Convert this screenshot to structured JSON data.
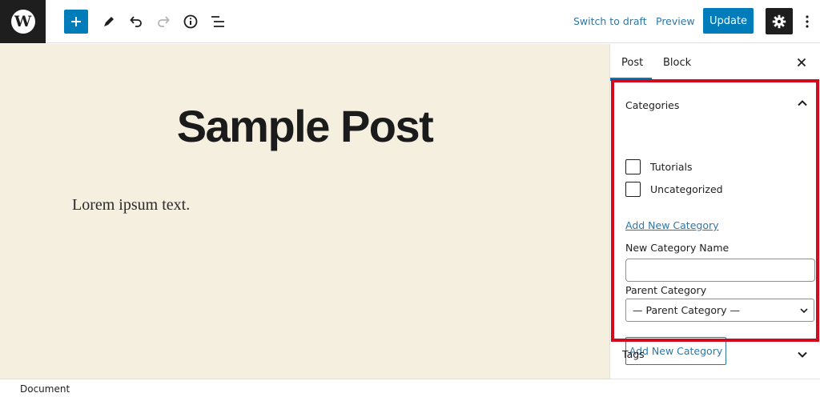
{
  "toolbar": {
    "logo_icon": "wordpress-logo",
    "logo_glyph": "W",
    "add_block_icon": "plus-icon",
    "tools_icon": "pencil-icon",
    "undo_icon": "undo-icon",
    "redo_icon": "redo-icon",
    "details_icon": "info-icon",
    "list_view_icon": "list-view-icon",
    "switch_to_draft": "Switch to draft",
    "preview": "Preview",
    "update": "Update",
    "settings_icon": "gear-icon",
    "more_icon": "kebab-menu-icon"
  },
  "editor": {
    "title": "Sample Post",
    "body": "Lorem ipsum text."
  },
  "sidebar": {
    "tabs": [
      {
        "label": "Post",
        "active": true
      },
      {
        "label": "Block",
        "active": false
      }
    ],
    "close_icon": "close-icon",
    "categories": {
      "title": "Categories",
      "expanded": true,
      "items": [
        {
          "label": "Tutorials",
          "checked": false
        },
        {
          "label": "Uncategorized",
          "checked": false
        }
      ],
      "add_new_link": "Add New Category",
      "new_name_label": "New Category Name",
      "new_name_value": "",
      "parent_label": "Parent Category",
      "parent_selected": "— Parent Category —",
      "add_button": "Add New Category"
    },
    "tags": {
      "title": "Tags",
      "expanded": false
    }
  },
  "footer": {
    "breadcrumb": "Document"
  },
  "colors": {
    "accent": "#007cba",
    "canvas_bg": "#f5efe0",
    "highlight_frame": "#d10a1d",
    "dark": "#1e1e1e"
  }
}
